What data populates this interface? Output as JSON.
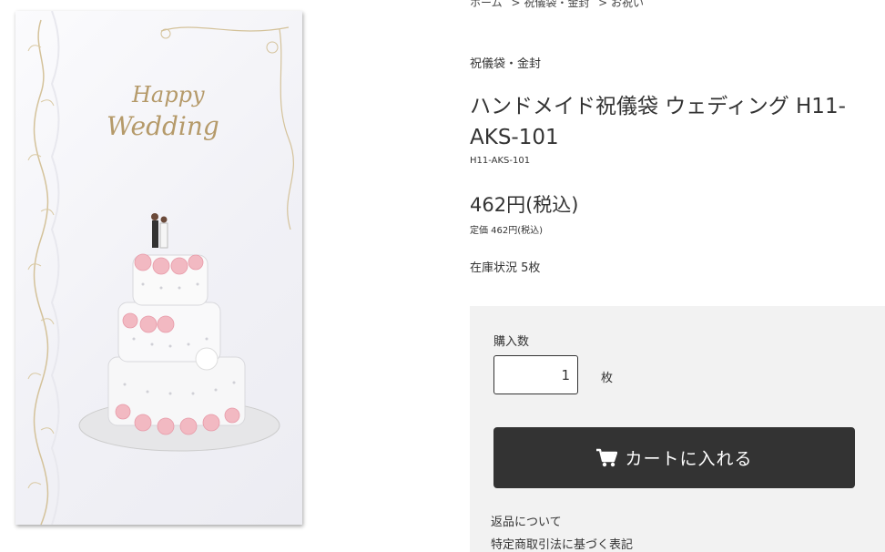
{
  "breadcrumb": [
    "ホーム",
    "> 祝儀袋・金封",
    "> お祝い"
  ],
  "product": {
    "category": "祝儀袋・金封",
    "title": "ハンドメイド祝儀袋 ウェディング H11-AKS-101",
    "sku": "H11-AKS-101",
    "price": "462円(税込)",
    "list_price": "定価 462円(税込)",
    "stock": "在庫状況 5枚",
    "image_text": {
      "line1": "Happy",
      "line2": "Wedding"
    }
  },
  "cart": {
    "qty_label": "購入数",
    "qty_value": "1",
    "unit": "枚",
    "button_label": "カートに入れる",
    "button_icon": "cart-icon"
  },
  "links": [
    "返品について",
    "特定商取引法に基づく表記"
  ],
  "colors": {
    "button_bg": "#333333",
    "panel_bg": "#f2f2f2",
    "gold": "#b59a6a",
    "rose": "#f2b9c2"
  }
}
